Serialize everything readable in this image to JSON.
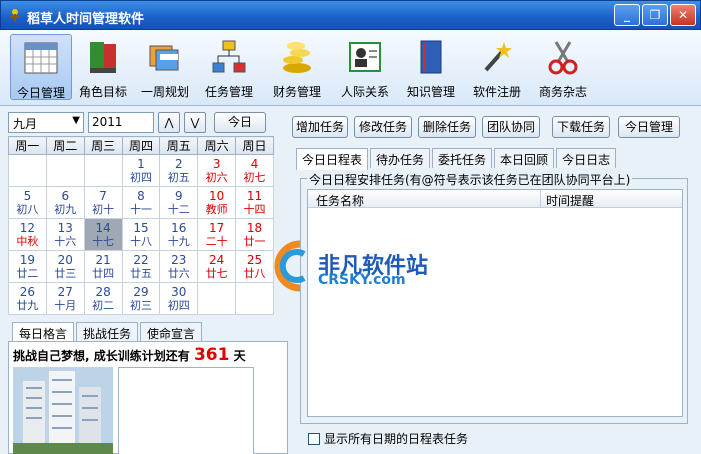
{
  "window": {
    "title": "稻草人时间管理软件",
    "buttons": {
      "minimize": "_",
      "restore": "❐",
      "close": "✕"
    }
  },
  "toolbar": [
    {
      "label": "今日管理",
      "icon": "calendar-grid-icon",
      "active": true
    },
    {
      "label": "角色目标",
      "icon": "books-icon"
    },
    {
      "label": "一周规划",
      "icon": "cards-icon"
    },
    {
      "label": "任务管理",
      "icon": "org-chart-icon"
    },
    {
      "label": "财务管理",
      "icon": "coins-icon"
    },
    {
      "label": "人际关系",
      "icon": "contact-card-icon"
    },
    {
      "label": "知识管理",
      "icon": "book-icon"
    },
    {
      "label": "软件注册",
      "icon": "magic-wand-icon"
    },
    {
      "label": "商务杂志",
      "icon": "scissors-icon"
    }
  ],
  "calendar": {
    "month": "九月",
    "year": "2011",
    "prev": "⋀",
    "next": "⋁",
    "today": "今日",
    "weekdays": [
      "周一",
      "周二",
      "周三",
      "周四",
      "周五",
      "周六",
      "周日"
    ],
    "weeks": [
      [
        null,
        null,
        null,
        {
          "d": "1",
          "l": "初四"
        },
        {
          "d": "2",
          "l": "初五"
        },
        {
          "d": "3",
          "l": "初六"
        },
        {
          "d": "4",
          "l": "初七"
        }
      ],
      [
        {
          "d": "5",
          "l": "初八"
        },
        {
          "d": "6",
          "l": "初九"
        },
        {
          "d": "7",
          "l": "初十"
        },
        {
          "d": "8",
          "l": "十一"
        },
        {
          "d": "9",
          "l": "十二"
        },
        {
          "d": "10",
          "l": "教师"
        },
        {
          "d": "11",
          "l": "十四"
        }
      ],
      [
        {
          "d": "12",
          "l": "中秋"
        },
        {
          "d": "13",
          "l": "十六"
        },
        {
          "d": "14",
          "l": "十七"
        },
        {
          "d": "15",
          "l": "十八"
        },
        {
          "d": "16",
          "l": "十九"
        },
        {
          "d": "17",
          "l": "二十"
        },
        {
          "d": "18",
          "l": "廿一"
        }
      ],
      [
        {
          "d": "19",
          "l": "廿二"
        },
        {
          "d": "20",
          "l": "廿三"
        },
        {
          "d": "21",
          "l": "廿四"
        },
        {
          "d": "22",
          "l": "廿五"
        },
        {
          "d": "23",
          "l": "廿六"
        },
        {
          "d": "24",
          "l": "廿七"
        },
        {
          "d": "25",
          "l": "廿八"
        }
      ],
      [
        {
          "d": "26",
          "l": "廿九"
        },
        {
          "d": "27",
          "l": "十月"
        },
        {
          "d": "28",
          "l": "初二"
        },
        {
          "d": "29",
          "l": "初三"
        },
        {
          "d": "30",
          "l": "初四"
        },
        null,
        null
      ]
    ],
    "selected_day": "14"
  },
  "motto": {
    "tabs": [
      "每日格言",
      "挑战任务",
      "使命宣言"
    ],
    "text_prefix": "挑战自己梦想, 成长训练计划还有",
    "days": "361",
    "text_suffix": "天"
  },
  "actions": [
    "增加任务",
    "修改任务",
    "删除任务",
    "团队协同",
    "下载任务",
    "今日管理"
  ],
  "schedule": {
    "tabs": [
      "今日日程表",
      "待办任务",
      "委托任务",
      "本日回顾",
      "今日日志"
    ],
    "group_title": "今日日程安排任务(有@符号表示该任务已在团队协同平台上)",
    "columns": [
      "任务名称",
      "时间提醒"
    ],
    "show_all_label": "显示所有日期的日程表任务"
  },
  "watermark": {
    "text": "非凡软件站",
    "sub": "CRSKY.com"
  }
}
